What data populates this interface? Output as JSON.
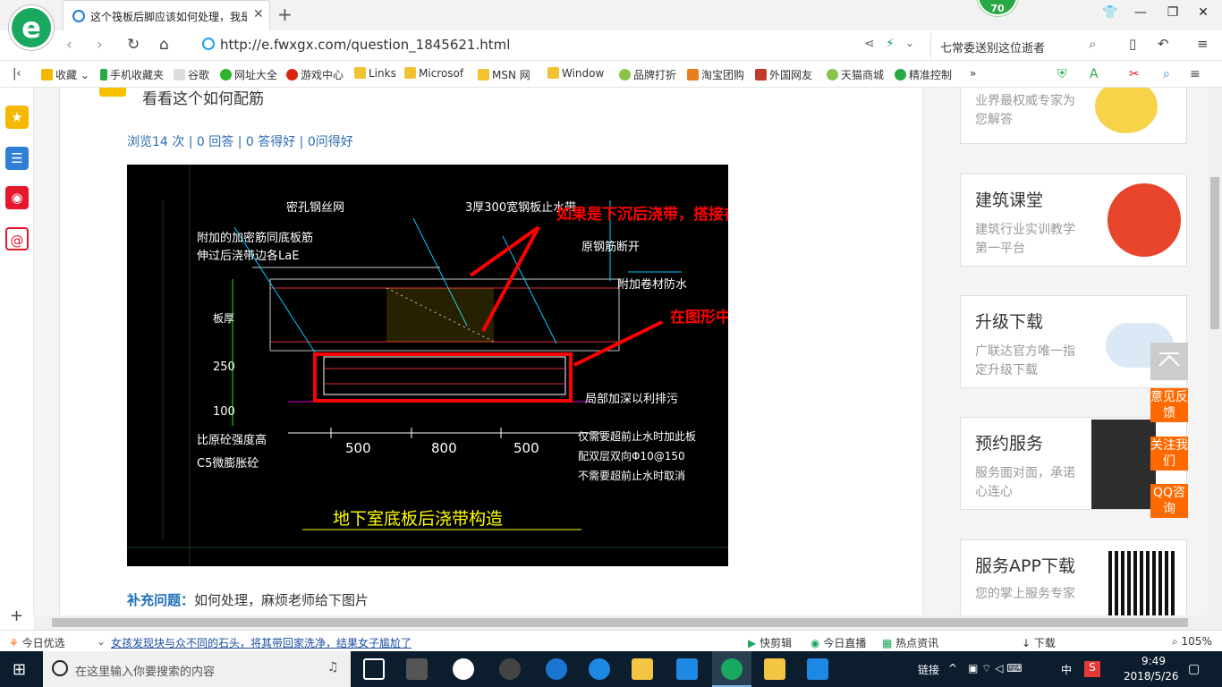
{
  "browser": {
    "tab_title": "这个筏板后脚应该如何处理，我是",
    "badge_count": "70",
    "url": "http://e.fwxgx.com/question_1845621.html",
    "search_placeholder": "七常委送别这位逝者",
    "bookmarks": [
      "收藏",
      "手机收藏夹",
      "谷歌",
      "网址大全",
      "游戏中心",
      "Links",
      "Microsof",
      "MSN 网",
      "Window",
      "品牌打折",
      "淘宝团购",
      "外国网友",
      "天猫商城",
      "精准控制"
    ]
  },
  "question": {
    "title": "看看这个如何配筋",
    "stats": "浏览14 次 | 0 回答 | 0 答得好 | 0问得好",
    "supplement_label": "补充问题：",
    "supplement_text": "如何处理，麻烦老师给下图片"
  },
  "cad": {
    "labels": [
      "密孔钢丝网",
      "3厚300宽钢板止水带",
      "附加的加密筋同底板筋",
      "伸过后浇带边各LaE",
      "原钢筋断开",
      "附加卷材防水",
      "局部加深以利排污",
      "比原砼强度高",
      "C5微膨胀砼",
      "仅需要超前止水时加此板",
      "配双层双向Φ10@150",
      "不需要超前止水时取消",
      "500",
      "800",
      "500",
      "250",
      "100",
      "板厚",
      "地下室底板后浇带构造"
    ],
    "annotation_1": "如果是下沉后浇带，搭接在其它钢筋中输入",
    "annotation_2": "在图形中输入"
  },
  "sidebar": [
    {
      "title": "",
      "desc": "业界最权威专家为您解答"
    },
    {
      "title": "建筑课堂",
      "desc": "建筑行业实训教学第一平台"
    },
    {
      "title": "升级下载",
      "desc": "广联达官方唯一指定升级下载"
    },
    {
      "title": "预约服务",
      "desc": "服务面对面，承诺心连心"
    },
    {
      "title": "服务APP下载",
      "desc": "您的掌上服务专家"
    }
  ],
  "float_buttons": [
    "意见反馈",
    "关注我们",
    "QQ咨询"
  ],
  "statusbar": {
    "left": "今日优选",
    "news": "女孩发现块与众不同的石头，将其带回家洗净，结果女子尴尬了",
    "items": [
      "快剪辑",
      "今日直播",
      "热点资讯",
      "下载"
    ],
    "zoom": "105%"
  },
  "taskbar": {
    "search_placeholder": "在这里输入你要搜索的内容",
    "tray_link": "链接",
    "ime": "中",
    "time": "9:49",
    "date": "2018/5/26"
  },
  "colors": {
    "accent_green": "#1aa861",
    "orange": "#ff6a00",
    "annotation_red": "#ff0000",
    "link_blue": "#2b6cb0"
  }
}
